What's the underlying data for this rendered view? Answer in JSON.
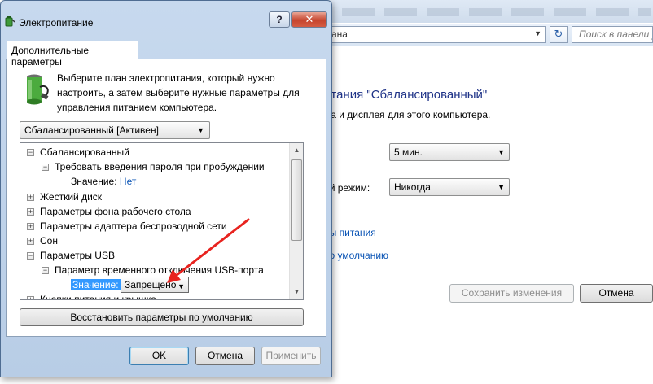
{
  "background_window": {
    "address_text": "ана",
    "search_placeholder": "Поиск в панели у",
    "heading": "итания \"Сбалансированный\"",
    "subtext": "ма и дисплея для этого компьютера.",
    "display_off_value": "5 мин.",
    "sleep_label": "ий режим:",
    "sleep_value": "Никогда",
    "link_power_settings": "ры питания",
    "link_defaults": "по умолчанию",
    "save_button": "Сохранить изменения",
    "cancel_button": "Отмена"
  },
  "dialog": {
    "title": "Электропитание",
    "help_label": "?",
    "close_label": "✕",
    "tab_label": "Дополнительные параметры",
    "intro_text": "Выберите план электропитания, который нужно настроить, а затем выберите нужные параметры для управления питанием компьютера.",
    "plan_select_value": "Сбалансированный [Активен]",
    "tree": {
      "root": "Сбалансированный",
      "password_setting": "Требовать введения пароля при пробуждении",
      "password_value_label": "Значение:",
      "password_value": "Нет",
      "hard_disk": "Жесткий диск",
      "desktop_background": "Параметры фона рабочего стола",
      "wireless_adapter": "Параметры адаптера беспроводной сети",
      "sleep": "Сон",
      "usb_settings": "Параметры USB",
      "usb_suspend": "Параметр временного отключения USB-порта",
      "usb_value_label": "Значение:",
      "usb_value": "Запрещено",
      "partial_next": "Кнопки питания и крышка"
    },
    "restore_defaults_button": "Восстановить параметры по умолчанию",
    "ok_button": "OK",
    "cancel_button": "Отмена",
    "apply_button": "Применить"
  },
  "colors": {
    "annotation_arrow": "#e8231f",
    "link_blue": "#0a54b5",
    "selection_blue": "#3399ff"
  }
}
